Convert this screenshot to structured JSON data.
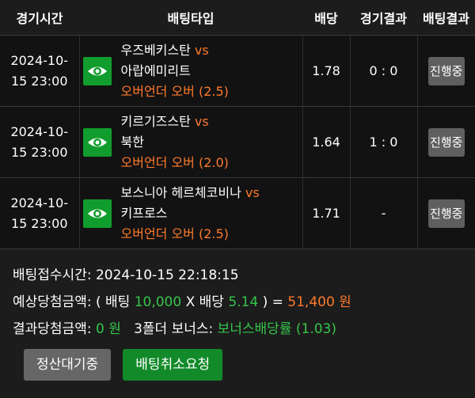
{
  "headers": {
    "time": "경기시간",
    "type": "배팅타입",
    "odds": "배당",
    "result": "경기결과",
    "bet_result": "배팅결과"
  },
  "rows": [
    {
      "date": "2024-10-",
      "datetime": "15 23:00",
      "home": "우즈베키스탄 ",
      "vs": "vs",
      "away": "아랍에미리트",
      "pick": "오버언더 오버 (2.5)",
      "odds": "1.78",
      "score": "0 : 0",
      "status": "진행중"
    },
    {
      "date": "2024-10-",
      "datetime": "15 23:00",
      "home": "키르기즈스탄 ",
      "vs": "vs",
      "away": "북한",
      "pick": "오버언더 오버 (2.0)",
      "odds": "1.64",
      "score": "1 : 0",
      "status": "진행중"
    },
    {
      "date": "2024-10-",
      "datetime": "15 23:00",
      "home": "보스니아 헤르체코비나 ",
      "vs": "vs",
      "away": "키프로스",
      "pick": "오버언더 오버 (2.5)",
      "odds": "1.71",
      "score": "-",
      "status": "진행중"
    }
  ],
  "info": {
    "receipt_label": "배팅접수시간: ",
    "receipt_time": "2024-10-15 22:18:15",
    "expected_label": "예상당첨금액: ( 배팅 ",
    "stake": "10,000",
    "x_odds": " X 배당 ",
    "total_odds": "5.14",
    "close_eq": " ) = ",
    "payout": "51,400 원",
    "result_label": "결과당첨금액: ",
    "result_amount": "0 원",
    "bonus_label": "   3폴더 보너스: ",
    "bonus_value": "보너스배당률 (1.03)"
  },
  "buttons": {
    "settle": "정산대기중",
    "cancel": "배팅취소요청"
  },
  "colors": {
    "accent_orange": "#ff7a2b",
    "accent_green": "#35c54a",
    "eye_button": "#119d2d",
    "status_gray": "#5f5f5f"
  }
}
